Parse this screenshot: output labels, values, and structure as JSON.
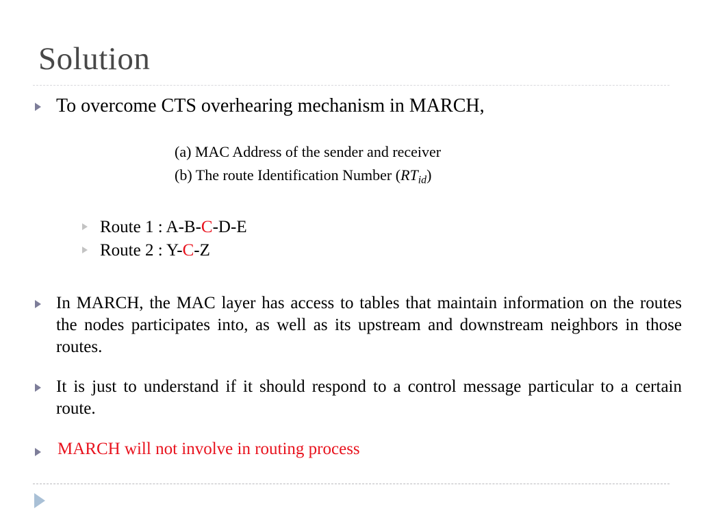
{
  "slide": {
    "title": "Solution",
    "lead_bullet": "To overcome CTS overhearing mechanism in MARCH,",
    "sub_notes": [
      "(a) MAC Address of the sender and receiver",
      "(b) The route Identification Number ("
    ],
    "sub_note_b_prefix": "(b) The route Identification Number (",
    "sub_note_b_var": "RT",
    "sub_note_b_sub": "id",
    "sub_note_b_suffix": ")",
    "routes": [
      {
        "prefix": "Route 1 : A-B-",
        "highlight": "C",
        "suffix": "-D-E"
      },
      {
        "prefix": "Route 2 : Y-",
        "highlight": "C",
        "suffix": "-Z"
      }
    ],
    "paragraphs": [
      "In MARCH, the MAC layer has access to tables that maintain information on the routes the nodes participates into, as well as its upstream and downstream neighbors in those routes.",
      "It  is just to understand if it should respond to a control message particular to a certain route."
    ],
    "red_statement": "MARCH will not involve in routing process",
    "colors": {
      "title": "#484848",
      "bullet": "#7d7d99",
      "sub_bullet": "#c3c3c3",
      "big_bullet": "#a9c0d6",
      "accent_red": "#e8121d",
      "rule_top": "#d8d8dc",
      "rule_bottom": "#b9b9bd",
      "body_text": "#000000",
      "background": "#ffffff"
    }
  }
}
